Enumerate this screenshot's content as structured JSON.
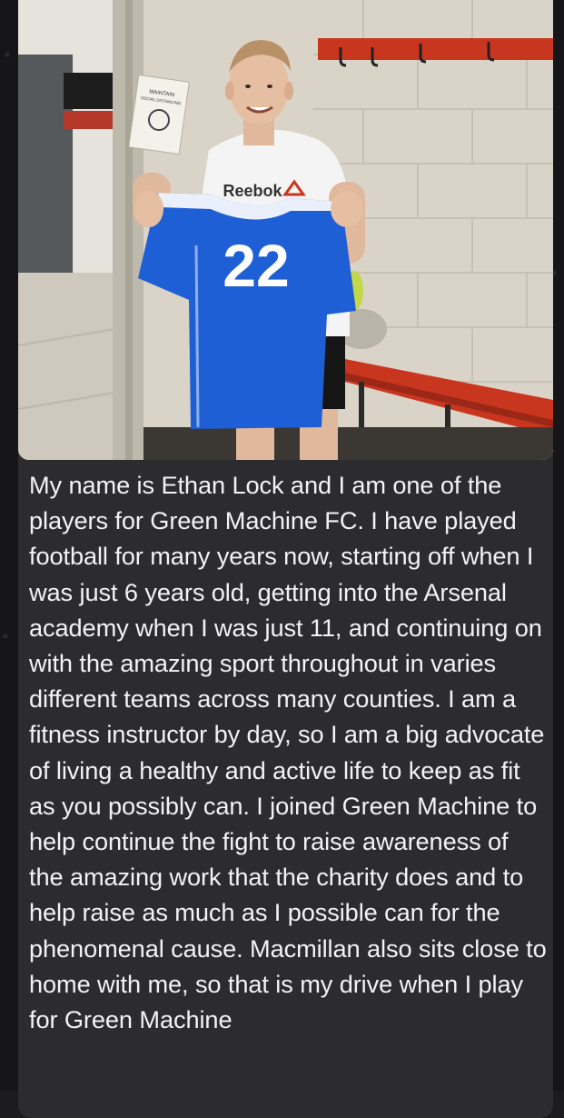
{
  "message": {
    "photo": {
      "sign_text": "MAINTAIN SOCIAL DISTANCING",
      "shirt_brand": "Reebok",
      "jersey_number": "22"
    },
    "text": "My name is Ethan Lock and I am one of the players for Green Machine FC. I have played football for many years now, starting off when I was just 6 years old, getting into the Arsenal academy when I was just 11, and continuing on with the amazing sport throughout in varies different teams across many counties. I am a fitness instructor by day, so I am a big advocate of living a healthy and active life to keep as fit as you possibly can. I joined Green Machine to help continue the fight to raise awareness of the amazing work that the charity does and to help raise as much as I possible can for the phenomenal cause. Macmillan also sits close to home with me, so that is my drive when I play for Green Machine"
  },
  "colors": {
    "bubble": "#2c2c2e",
    "text": "#f2f2f7",
    "jersey": "#1f5fd6",
    "bench": "#c9361f"
  }
}
